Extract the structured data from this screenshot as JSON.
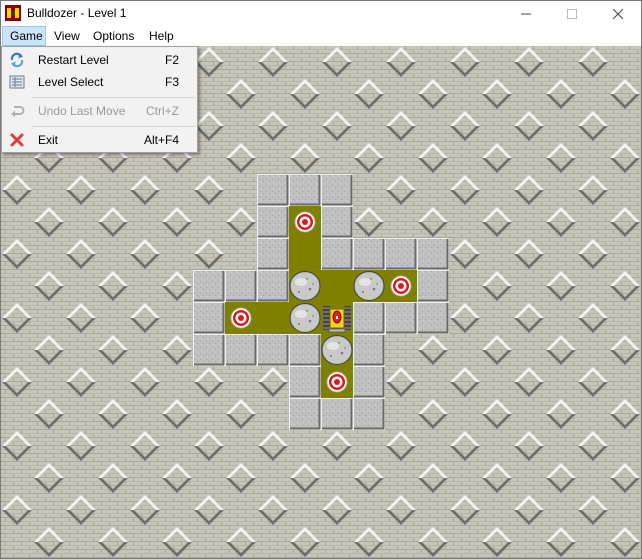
{
  "window": {
    "title": "Bulldozer - Level 1",
    "icon": "bulldozer-app-icon"
  },
  "titlebar_buttons": {
    "minimize": "minimize-icon",
    "maximize": "maximize-icon",
    "close": "close-icon"
  },
  "menubar": {
    "items": [
      {
        "label": "Game",
        "active": true
      },
      {
        "label": "View",
        "active": false
      },
      {
        "label": "Options",
        "active": false
      },
      {
        "label": "Help",
        "active": false
      }
    ]
  },
  "game_menu": {
    "items": [
      {
        "label": "Restart Level",
        "shortcut": "F2",
        "icon": "restart-icon",
        "enabled": true
      },
      {
        "label": "Level Select",
        "shortcut": "F3",
        "icon": "level-select-icon",
        "enabled": true
      },
      {
        "label": "Undo Last Move",
        "shortcut": "Ctrl+Z",
        "icon": "undo-icon",
        "enabled": false
      },
      {
        "label": "Exit",
        "shortcut": "Alt+F4",
        "icon": "exit-icon",
        "enabled": true
      }
    ]
  },
  "board": {
    "legend": {
      "B": "background brick",
      "W": "wall block",
      "F": "floor",
      "T": "target",
      "R": "boulder",
      "D": "bulldozer"
    },
    "rows": [
      "BBBBBBBBBBBBBBBBBBBB",
      "BBBBBBBBBBBBBBBBBBBB",
      "BBBBBBBBBBBBBBBBBBBB",
      "BBBBBBBBBBBBBBBBBBBB",
      "BBBBBBBBWWWBBBBBBBBB",
      "BBBBBBBBWTWBBBBBBBBB",
      "BBBBBBBBWFWWWWBBBBBB",
      "BBBBBBWWWRFRTWBBBBBB",
      "BBBBBBWTFRDWWWBBBBBB",
      "BBBBBBWWWWRWBBBBBBBB",
      "BBBBBBBBBWTWBBBBBBBB",
      "BBBBBBBBBWWWBBBBBBBB",
      "BBBBBBBBBBBBBBBBBBBB",
      "BBBBBBBBBBBBBBBBBBBB",
      "BBBBBBBBBBBBBBBBBBBB",
      "BBBBBBBBBBBBBBBBBBBB"
    ]
  },
  "colors": {
    "brick": "#c7c5b8",
    "mortar": "#a9a79b",
    "diamond_light": "#f4f4f4",
    "diamond_dark": "#6e6e6e",
    "diamond_face": "#b8b8b8",
    "wall": "#c0c0c0",
    "floor": "#7f7f00",
    "target_red": "#e01818",
    "boulder": "#c9c9c9",
    "dozer_yellow": "#f2d21a",
    "menu_active": "#cce4f7"
  }
}
